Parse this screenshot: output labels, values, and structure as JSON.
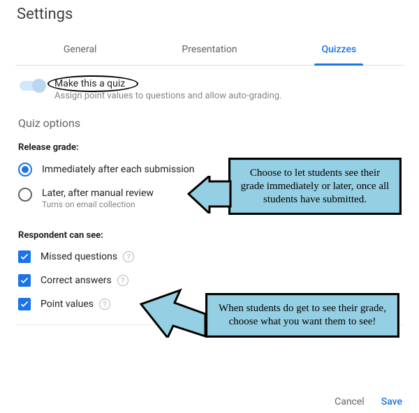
{
  "title": "Settings",
  "tabs": {
    "general": "General",
    "presentation": "Presentation",
    "quizzes": "Quizzes"
  },
  "toggle": {
    "label": "Make this a quiz",
    "sub": "Assign point values to questions and allow auto-grading."
  },
  "section_quiz_options": "Quiz options",
  "release_grade": {
    "label": "Release grade:",
    "opt1": "Immediately after each submission",
    "opt2": "Later, after manual review",
    "opt2_sub": "Turns on email collection"
  },
  "respondent_can_see": {
    "label": "Respondent can see:",
    "missed": "Missed questions",
    "correct": "Correct answers",
    "points": "Point values"
  },
  "footer": {
    "cancel": "Cancel",
    "save": "Save"
  },
  "callouts": {
    "c1": "Choose to let students see their grade immediately or later, once all students have submitted.",
    "c2": "When students do get to see their grade, choose what you want them to see!"
  }
}
